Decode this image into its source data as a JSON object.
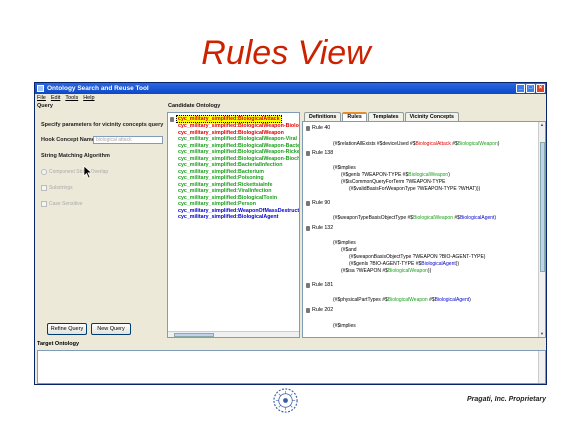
{
  "slide": {
    "title": "Rules View",
    "footer": "Pragati, Inc. Proprietary",
    "logo_icon": "pragati-logo"
  },
  "window": {
    "title": "Ontology Search and Reuse Tool",
    "menu": [
      "File",
      "Edit",
      "Tools",
      "Help"
    ]
  },
  "query": {
    "section_label": "Query",
    "heading": "Specify parameters for vicinity concepts query",
    "hook_label": "Hook Concept Name:",
    "hook_value": "biological attack",
    "algo_label": "String Matching Algorithm",
    "options": [
      "Component String Overlap",
      "Substrings",
      "Case Sensitive"
    ],
    "refine_button": "Refine Query",
    "new_button": "New Query"
  },
  "candidate": {
    "section_label": "Candidate Ontology",
    "root": "cyc_military_simplified:BiologicalAttack",
    "items": [
      {
        "label": "cyc_military_simplified:BiologicalWeapon-Biologi",
        "color": "#e00000"
      },
      {
        "label": "cyc_military_simplified:BiologicalWeapon",
        "color": "#e00000"
      },
      {
        "label": "cyc_military_simplified:BiologicalWeapon-Viral",
        "color": "#1a9e1a"
      },
      {
        "label": "cyc_military_simplified:BiologicalWeapon-Bacter",
        "color": "#1a9e1a"
      },
      {
        "label": "cyc_military_simplified:BiologicalWeapon-Ricket",
        "color": "#1a9e1a"
      },
      {
        "label": "cyc_military_simplified:BiologicalWeapon-Bioche",
        "color": "#1a9e1a"
      },
      {
        "label": "cyc_military_simplified:BacterialInfection",
        "color": "#1a9e1a"
      },
      {
        "label": "cyc_military_simplified:Bacterium",
        "color": "#1a9e1a"
      },
      {
        "label": "cyc_military_simplified:Poisoning",
        "color": "#1a9e1a"
      },
      {
        "label": "cyc_military_simplified:RickettsiaInfe",
        "color": "#1a9e1a"
      },
      {
        "label": "cyc_military_simplified:ViralInfection",
        "color": "#1a9e1a"
      },
      {
        "label": "cyc_military_simplified:BiologicalToxin",
        "color": "#1a9e1a"
      },
      {
        "label": "cyc_military_simplified:Person",
        "color": "#1a9e1a"
      },
      {
        "label": "cyc_military_simplified:WeaponOfMassDestructi",
        "color": "#0000cc"
      },
      {
        "label": "cyc_military_simplified:BiologicalAgent",
        "color": "#0000cc"
      }
    ]
  },
  "rules": {
    "tabs": [
      "Definitions",
      "Rules",
      "Templates",
      "Vicinity Concepts"
    ],
    "active_tab": "Rules",
    "rule40": "Rule 40",
    "rule40_line": {
      "a": "(#$relationAllExists #$deviceUsed #$",
      "b": "BiologicalAttack",
      "c": " #$",
      "d": "BiologicalWeapon",
      "e": ")"
    },
    "rule138": "Rule 138",
    "rule138_l1": "(#$implies",
    "rule138_l2": {
      "a": "(#$genls ?WEAPON-TYPE #$",
      "b": "BiologicalWeapon",
      "c": ")"
    },
    "rule138_l3": "(#$isCommonQueryForTerm ?WEAPON-TYPE",
    "rule138_l4": "(#$validBasisForWeaponType ?WEAPON-TYPE ?WHAT)))",
    "rule90": "Rule 90",
    "rule90_line": {
      "a": "(#$weaponTypeBasisObjectType #$",
      "b": "BiologicalWeapon",
      "c": " #$",
      "d": "BiologicalAgent",
      "e": ")"
    },
    "rule132": "Rule 132",
    "rule132_l1": "(#$implies",
    "rule132_l2": "(#$and",
    "rule132_l3": "(#$weaponBasisObjectType ?WEAPON ?BIO-AGENT-TYPE)",
    "rule132_l4": {
      "a": "(#$genls ?BIO-AGENT-TYPE #$",
      "b": "BiologicalAgent",
      "c": "))"
    },
    "rule132_l5": {
      "a": "(#$isa ?WEAPON #$",
      "b": "BiologicalWeapon",
      "c": "))"
    },
    "rule181": "Rule 181",
    "rule181_line": {
      "a": "(#$physicalPartTypes #$",
      "b": "BiologicalWeapon",
      "c": " #$",
      "d": "BiologicalAgent",
      "e": ")"
    },
    "rule202": "Rule 202",
    "rule202_l1": "(#$implies"
  },
  "target": {
    "section_label": "Target Ontology"
  }
}
